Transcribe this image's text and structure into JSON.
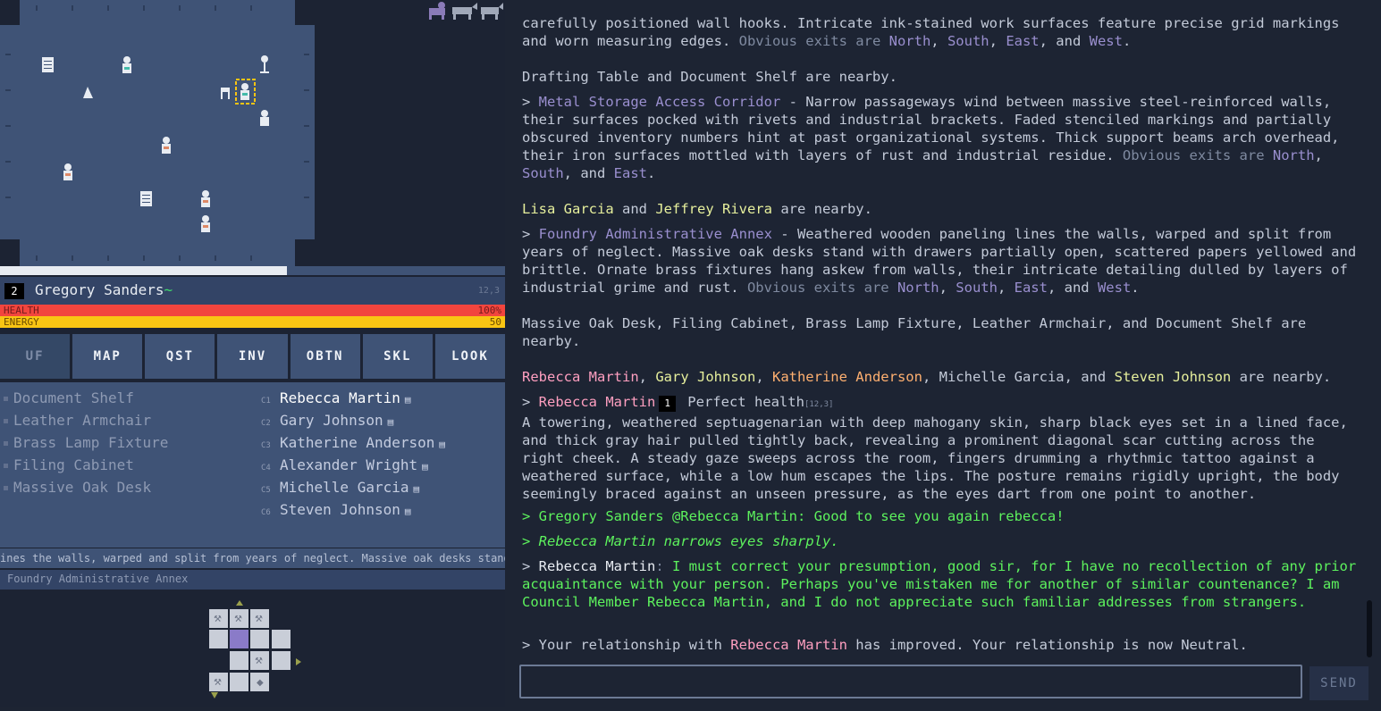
{
  "character": {
    "level": "2",
    "name": "Gregory Sanders",
    "name_suffix": "~",
    "coords": "12,3"
  },
  "stats": {
    "health_label": "HEALTH",
    "health_value": "100%",
    "energy_label": "ENERGY",
    "energy_value": "50"
  },
  "tabs": [
    "UF",
    "MAP",
    "QST",
    "INV",
    "OBTN",
    "SKL",
    "LOOK"
  ],
  "objects": [
    "Document Shelf",
    "Leather Armchair",
    "Brass Lamp Fixture",
    "Filing Cabinet",
    "Massive Oak Desk"
  ],
  "characters": [
    {
      "code": "C1",
      "name": "Rebecca Martin"
    },
    {
      "code": "C2",
      "name": "Gary Johnson"
    },
    {
      "code": "C3",
      "name": "Katherine Anderson"
    },
    {
      "code": "C4",
      "name": "Alexander Wright"
    },
    {
      "code": "C5",
      "name": "Michelle Garcia"
    },
    {
      "code": "C6",
      "name": "Steven Johnson"
    }
  ],
  "ticker": "ines the walls, warped and split from years of neglect. Massive oak desks stand",
  "location": "Foundry Administrative Annex",
  "colors": {
    "accent": "#9a8fcf",
    "speech": "#5df25d",
    "health": "#f2453e",
    "energy": "#f9c513"
  },
  "log": {
    "p1_text": "carefully positioned wall hooks. Intricate ink-stained work surfaces feature precise grid markings and worn measuring edges. ",
    "p1_exits": "Obvious exits are ",
    "p1_d1": "North",
    "p1_s1": ", ",
    "p1_d2": "South",
    "p1_s2": ", ",
    "p1_d3": "East",
    "p1_s3": ", and ",
    "p1_d4": "West",
    "p1_end": ".",
    "p2": "Drafting Table and Document Shelf are nearby.",
    "p3_prefix": "> ",
    "p3_loc": "Metal Storage Access Corridor",
    "p3_text": " - Narrow passageways wind between massive steel-reinforced walls, their surfaces pocked with rivets and industrial brackets. Faded stenciled markings and partially obscured inventory numbers hint at past organizational systems. Thick support beams arch overhead, their iron surfaces mottled with layers of rust and industrial residue. ",
    "p3_exits": "Obvious exits are ",
    "p3_d1": "North",
    "p3_s1": ", ",
    "p3_d2": "South",
    "p3_s2": ", and ",
    "p3_d3": "East",
    "p3_end": ".",
    "p4_a": "Lisa Garcia",
    "p4_and": " and ",
    "p4_b": "Jeffrey Rivera",
    "p4_end": " are nearby.",
    "p5_prefix": "> ",
    "p5_loc": "Foundry Administrative Annex",
    "p5_text": " - Weathered wooden paneling lines the walls, warped and split from years of neglect. Massive oak desks stand with drawers partially open, scattered papers yellowed and brittle. Ornate brass fixtures hang askew from walls, their intricate detailing dulled by layers of industrial grime and rust. ",
    "p5_exits": "Obvious exits are ",
    "p5_d1": "North",
    "p5_s1": ", ",
    "p5_d2": "South",
    "p5_s2": ", ",
    "p5_d3": "East",
    "p5_s3": ", and ",
    "p5_d4": "West",
    "p5_end": ".",
    "p6": "Massive Oak Desk, Filing Cabinet, Brass Lamp Fixture, Leather Armchair, and Document Shelf are nearby.",
    "p7_a": "Rebecca Martin",
    "p7_s1": ", ",
    "p7_b": "Gary Johnson",
    "p7_s2": ", ",
    "p7_c": "Katherine Anderson",
    "p7_s3": ", Michelle Garcia, and ",
    "p7_d": "Steven Johnson",
    "p7_end": " are nearby.",
    "p8_prefix": "> ",
    "p8_name": "Rebecca Martin",
    "p8_level": "1",
    "p8_health": " Perfect health",
    "p8_coords": "[12,3]",
    "p8_desc": "A towering, weathered septuagenarian with deep mahogany skin, sharp black eyes set in a lined face, and thick gray hair pulled tightly back, revealing a prominent diagonal scar cutting across the right cheek. A steady gaze sweeps across the room, fingers drumming a rhythmic tattoo against a weathered surface, while a low hum escapes the lips. The posture remains rigidly upright, the body seemingly braced against an unseen pressure, as the eyes dart from one point to another.",
    "p9": "> Gregory Sanders @Rebecca Martin: Good to see you again rebecca!",
    "p10": "> Rebecca Martin narrows eyes sharply.",
    "p11_prefix": "> ",
    "p11_name": "Rebecca Martin",
    "p11_colon": ": ",
    "p11_text": "I must correct your presumption, good sir, for I have no recollection of any prior acquaintance with your person. Perhaps you've mistaken me for another of similar countenance? I am Council Member Rebecca Martin, and I do not appreciate such familiar addresses from strangers.",
    "p12_a": "> Your relationship with ",
    "p12_name": "Rebecca Martin",
    "p12_b": " has improved. Your relationship is now Neutral."
  },
  "chat": {
    "placeholder": "",
    "send_label": "SEND"
  }
}
